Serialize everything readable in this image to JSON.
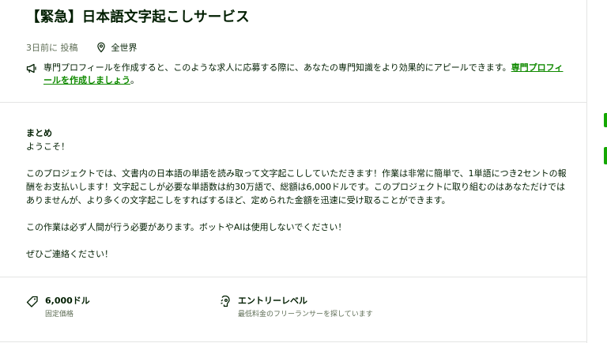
{
  "job": {
    "title": "【緊急】日本語文字起こしサービス",
    "posted": "3日前に 投稿",
    "location": "全世界"
  },
  "notice": {
    "text": "専門プロフィールを作成すると、このような求人に応募する際に、あなたの専門知識をより効果的にアピールできます。",
    "link": "専門プロフィールを作成しましょう",
    "suffix": "。"
  },
  "summary": {
    "label": "まとめ",
    "greeting": "ようこそ！",
    "paragraph1": "このプロジェクトでは、文書内の日本語の単語を読み取って文字起こししていただきます！作業は非常に簡単で、1単語につき2セントの報酬をお支払いします！文字起こしが必要な単語数は約30万語で、総額は6,000ドルです。このプロジェクトに取り組むのはあなただけではありませんが、より多くの文字起こしをすればするほど、定められた金額を迅速に受け取ることができます。",
    "paragraph2": "この作業は必ず人間が行う必要があります。ボットやAIは使用しないでください！",
    "paragraph3": "ぜひご連絡ください！"
  },
  "features": [
    {
      "title": "6,000ドル",
      "subtitle": "固定価格",
      "icon": "price-tag-icon"
    },
    {
      "title": "エントリーレベル",
      "subtitle": "最低料金のフリーランサーを探しています",
      "icon": "experience-level-icon"
    }
  ],
  "colors": {
    "accent": "#14a800",
    "link": "#108a00",
    "text": "#001e00",
    "muted": "#5e6d55",
    "border": "#e4e5e4"
  }
}
